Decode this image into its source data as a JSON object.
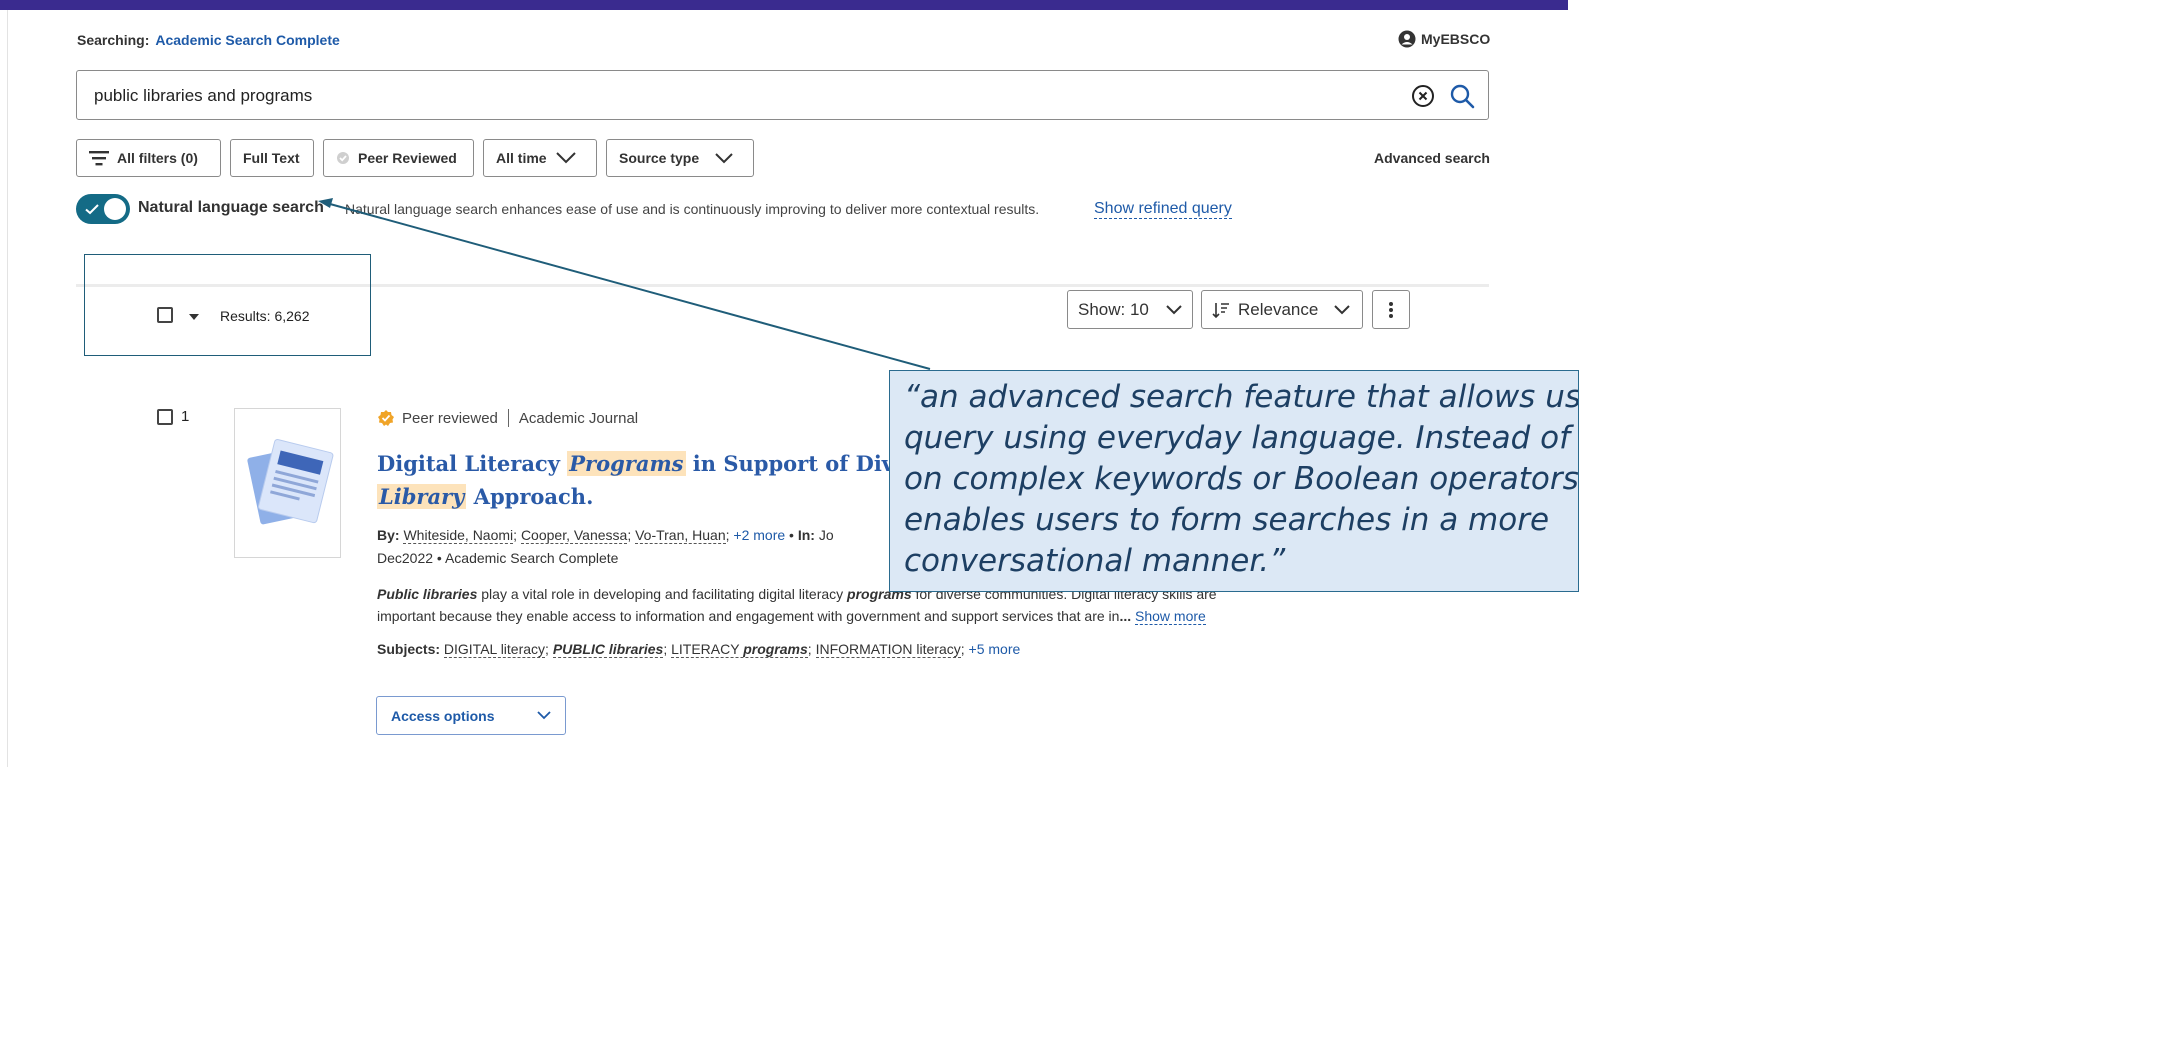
{
  "header": {
    "searching_label": "Searching:",
    "database": "Academic Search Complete",
    "account_label": "MyEBSCO"
  },
  "search": {
    "query": "public libraries and programs"
  },
  "filters": {
    "all_filters": "All filters (0)",
    "full_text": "Full Text",
    "peer_reviewed": "Peer Reviewed",
    "all_time": "All time",
    "source_type": "Source type",
    "advanced_search": "Advanced search"
  },
  "natural_language": {
    "enabled": true,
    "label": "Natural language search",
    "description": "Natural language search enhances ease of use and is continuously improving to deliver more contextual results.",
    "link": "Show refined query"
  },
  "results_bar": {
    "count_label": "Results: 6,262",
    "show": "Show: 10",
    "sort": "Relevance"
  },
  "result": {
    "index": "1",
    "peer_reviewed": "Peer reviewed",
    "type": "Academic Journal",
    "title_parts": [
      "Digital Literacy ",
      "Programs",
      " in Support of Divers",
      "Library",
      " Approach."
    ],
    "by_label": "By:",
    "authors": [
      "Whiteside, Naomi",
      "Cooper, Vanessa",
      "Vo-Tran, Huan"
    ],
    "authors_more": "+2 more",
    "in_label": "In:",
    "in_text": "Jo",
    "date_line": "Dec2022 • Academic Search Complete",
    "abstract_lead": "Public libraries",
    "abstract_line1": " play a vital role in developing and facilitating digital literacy ",
    "abstract_bold2": "programs",
    "abstract_line1b": " for diverse communities. Digital literacy skills are",
    "abstract_line2": "important because they enable access to information and engagement with government and support services that are in",
    "abstract_ellipsis": "...",
    "show_more": "Show more",
    "subjects_label": "Subjects:",
    "subjects": [
      {
        "plain": "DIGITAL literacy",
        "bold": ""
      },
      {
        "plain": "",
        "bold": "PUBLIC libraries"
      },
      {
        "plain": "LITERACY ",
        "bold": "programs"
      },
      {
        "plain": "INFORMATION literacy",
        "bold": ""
      }
    ],
    "subjects_more": "+5 more",
    "access_options": "Access options"
  },
  "annotation": {
    "quote_lines": [
      "“an advanced search feature that allows users to",
      "query using everyday language. Instead of relying",
      "on complex keywords or Boolean operators, it",
      "enables users to form searches in a more",
      "conversational manner.”"
    ]
  },
  "colors": {
    "top_bar": "#3a2b8f",
    "link_blue": "#1e5aa8",
    "toggle_on": "#146b86",
    "highlight": "#fde3bb",
    "callout_fill": "#dce8f5"
  }
}
